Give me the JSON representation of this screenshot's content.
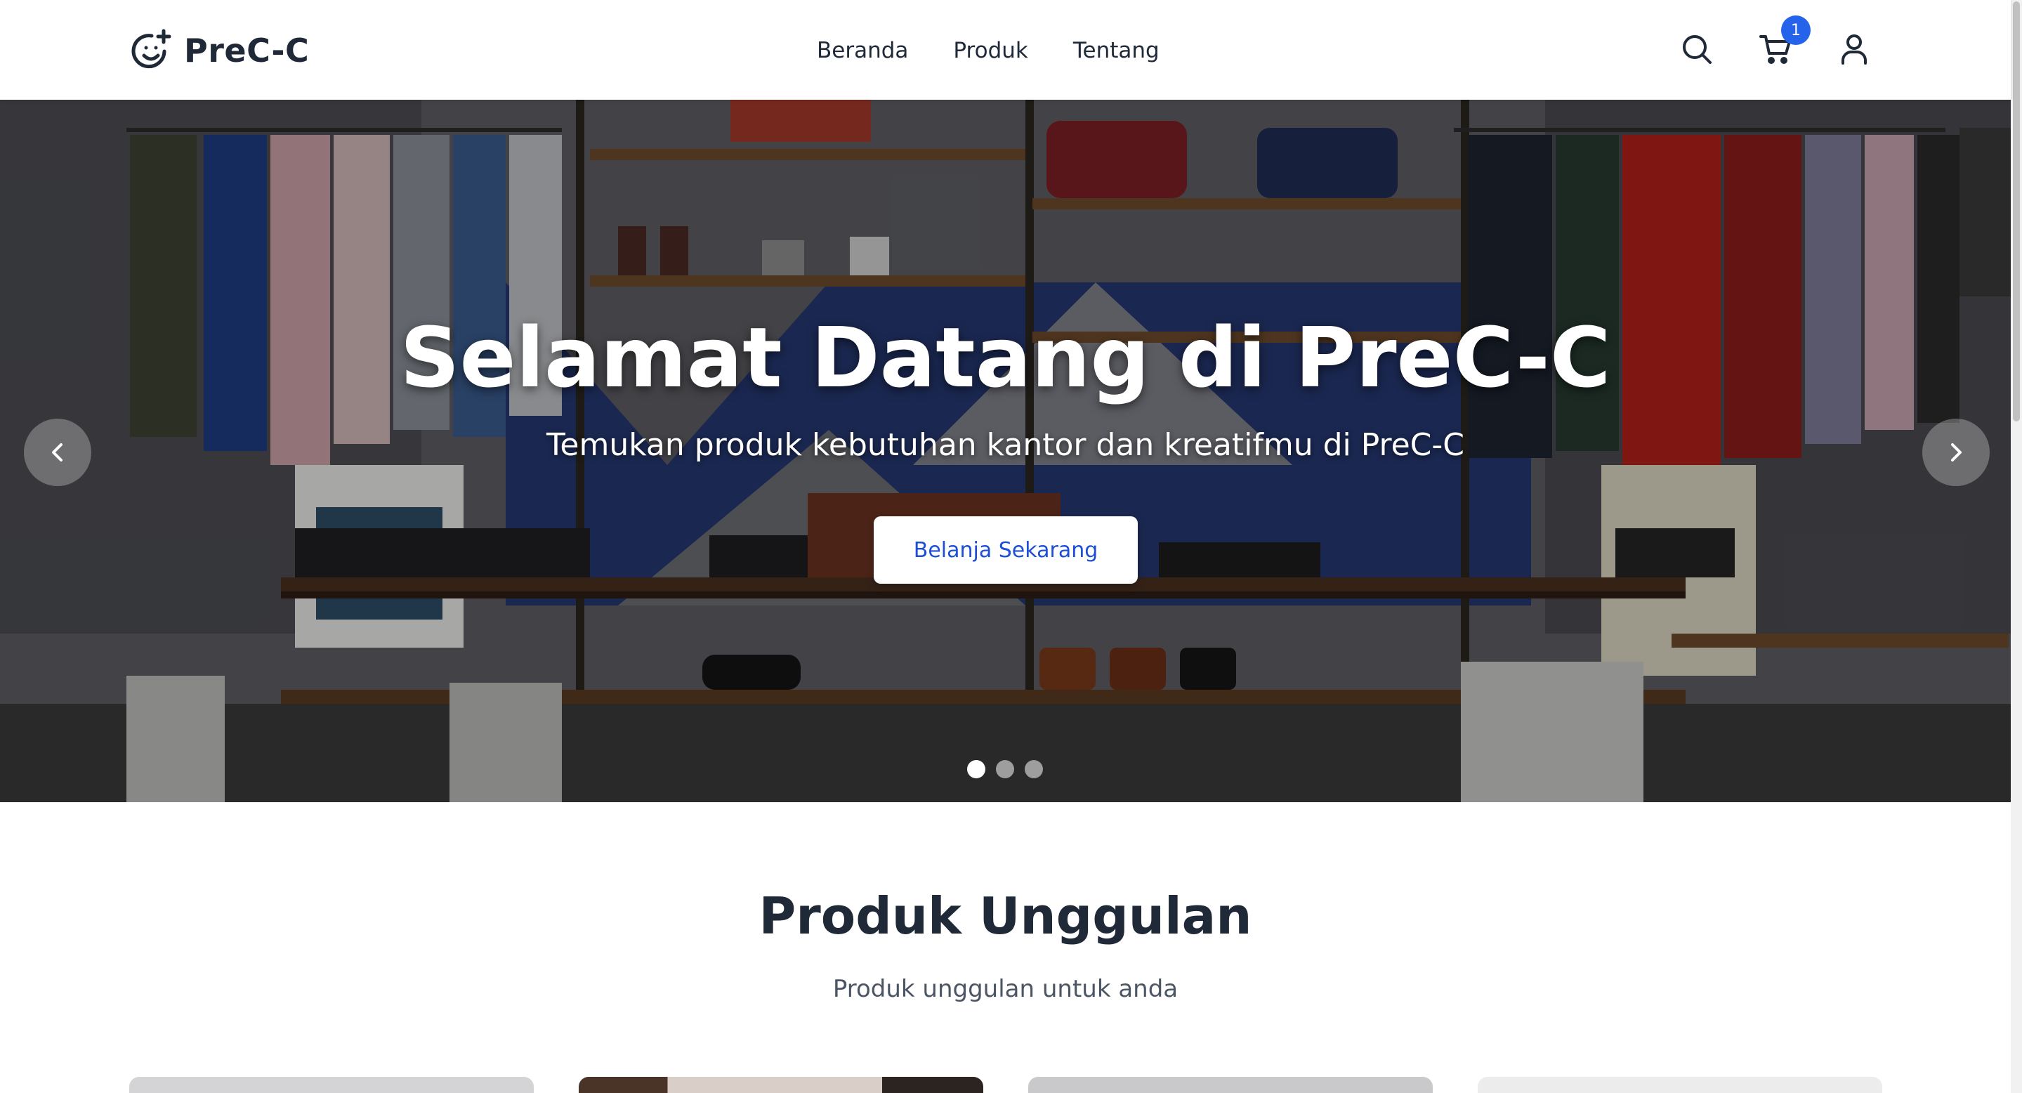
{
  "brand": {
    "name": "PreC-C",
    "icon": "face-plus-icon"
  },
  "nav": {
    "items": [
      {
        "label": "Beranda"
      },
      {
        "label": "Produk"
      },
      {
        "label": "Tentang"
      }
    ]
  },
  "header_actions": {
    "search_icon": "search-icon",
    "cart_icon": "cart-icon",
    "cart_count": "1",
    "user_icon": "user-icon",
    "badge_color": "#2563eb"
  },
  "hero": {
    "title": "Selamat Datang di PreC-C",
    "subtitle": "Temukan produk kebutuhan kantor dan kreatifmu di PreC-C",
    "cta_label": "Belanja Sekarang",
    "slide_count": 3,
    "active_slide": 1,
    "prev_icon": "chevron-left-icon",
    "next_icon": "chevron-right-icon",
    "image": "clothing-store-interior"
  },
  "featured": {
    "title": "Produk Unggulan",
    "subtitle": "Produk unggulan untuk anda"
  },
  "colors": {
    "accent": "#1d4ed8",
    "text_dark": "#1f2937",
    "text_muted": "#4b5563"
  }
}
